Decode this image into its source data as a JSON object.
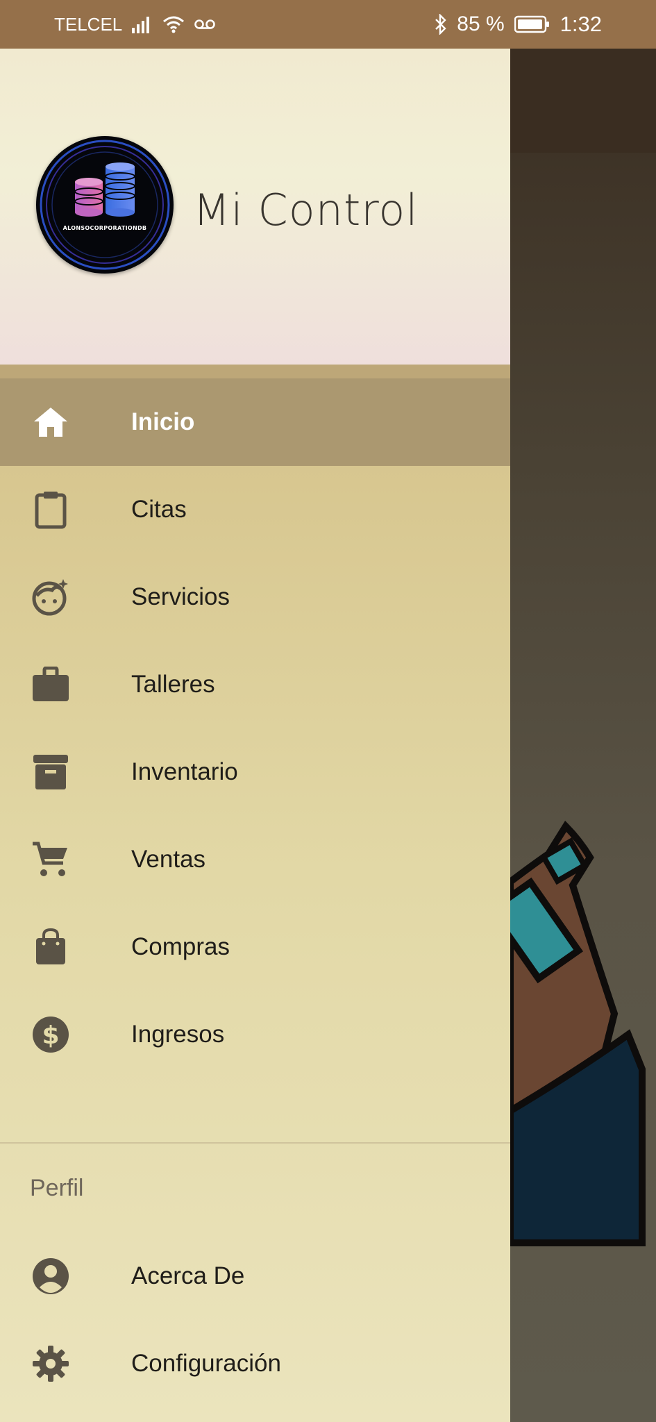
{
  "status_bar": {
    "carrier": "TELCEL",
    "battery": "85 %",
    "time": "1:32",
    "icons": [
      "signal-icon",
      "wifi-icon",
      "voicemail-icon",
      "bluetooth-icon",
      "battery-icon"
    ]
  },
  "drawer": {
    "app_title": "Mi Control",
    "logo_text": "ALONSOCORPORATIONDB",
    "menu": [
      {
        "label": "Inicio",
        "icon": "home-icon",
        "active": true
      },
      {
        "label": "Citas",
        "icon": "clipboard-icon",
        "active": false
      },
      {
        "label": "Servicios",
        "icon": "face-icon",
        "active": false
      },
      {
        "label": "Talleres",
        "icon": "briefcase-icon",
        "active": false
      },
      {
        "label": "Inventario",
        "icon": "archive-box-icon",
        "active": false
      },
      {
        "label": "Ventas",
        "icon": "shopping-cart-icon",
        "active": false
      },
      {
        "label": "Compras",
        "icon": "shopping-bag-icon",
        "active": false
      },
      {
        "label": "Ingresos",
        "icon": "dollar-icon",
        "active": false
      }
    ],
    "section_label": "Perfil",
    "profile_menu": [
      {
        "label": "Acerca De",
        "icon": "account-circle-icon"
      },
      {
        "label": "Configuración",
        "icon": "settings-gear-icon"
      }
    ]
  },
  "colors": {
    "status_bar": "#95704a",
    "active_item": "#ab9870",
    "icon": "#5a5346",
    "text": "#1f1d19"
  }
}
